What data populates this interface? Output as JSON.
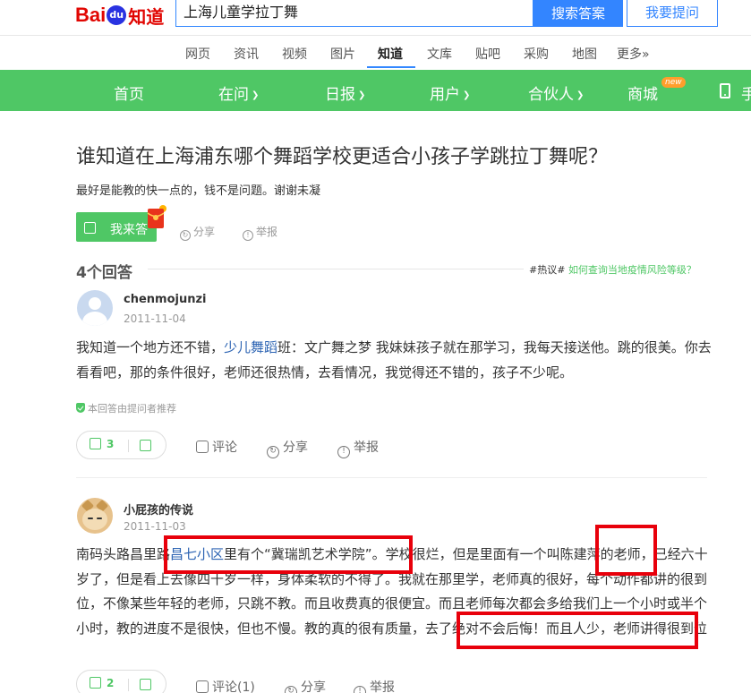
{
  "header": {
    "logo_bai": "Bai",
    "logo_du": "du",
    "logo_zhidao": "知道",
    "search_value": "上海儿童学拉丁舞",
    "search_button": "搜索答案",
    "ask_button": "我要提问"
  },
  "subnav": {
    "items": [
      "网页",
      "资讯",
      "视频",
      "图片",
      "知道",
      "文库",
      "贴吧",
      "采购",
      "地图",
      "更多»"
    ],
    "active": "知道"
  },
  "greennav": {
    "items": [
      "首页",
      "在问",
      "日报",
      "用户",
      "合伙人",
      "商城",
      "手"
    ],
    "new_badge": "new"
  },
  "question": {
    "title": "谁知道在上海浦东哪个舞蹈学校更适合小孩子学跳拉丁舞呢？",
    "description": "最好是能教的快一点的，钱不是问题。谢谢未凝",
    "answer_button": "我来答",
    "share": "分享",
    "report": "举报"
  },
  "answers_header": {
    "count": "4个回答",
    "hot_prefix": "#热议#",
    "hot_link": "如何查询当地疫情风险等级？"
  },
  "answers": [
    {
      "user": "chenmojunzi",
      "date": "2011-11-04",
      "text_before_link": "我知道一个地方还不错，",
      "link": "少儿舞蹈",
      "text_after_link": "班：文广舞之梦 我妹妹孩子就在那学习，我每天接送他。跳的很美。你去看看吧，那的条件很好，老师还很热情，去看情况，我觉得还不错的，孩子不少呢。",
      "recommend": "本回答由提问者推荐",
      "likes": "3",
      "comment": "评论",
      "share": "分享",
      "report": "举报"
    },
    {
      "user": "小屁孩的传说",
      "date": "2011-11-03",
      "text_before_link": "南码头路昌里路",
      "link": "昌七小区",
      "text_after_link": "里有个“冀瑞凯艺术学院”。学校很烂，但是里面有一个叫陈建萍的老师，已经六十岁了，但是看上去像四十岁一样，身体柔软的不得了。我就在那里学，老师真的很好，每个动作都讲的很到位，不像某些年轻的老师，只跳不教。而且收费真的很便宜。而且老师每次都会多给我们上一个小时或半个小时，教的进度不是很快，但也不慢。教的真的很有质量，去了绝对不会后悔！而且人少，老师讲得很到位",
      "likes": "2",
      "comment": "评论",
      "comment_count": "(1)",
      "share": "分享",
      "report": "举报"
    }
  ],
  "colors": {
    "brand_green": "#4fc765",
    "search_blue": "#3385ff",
    "link_blue": "#2d64b3",
    "highlight_red": "#e8000b"
  }
}
